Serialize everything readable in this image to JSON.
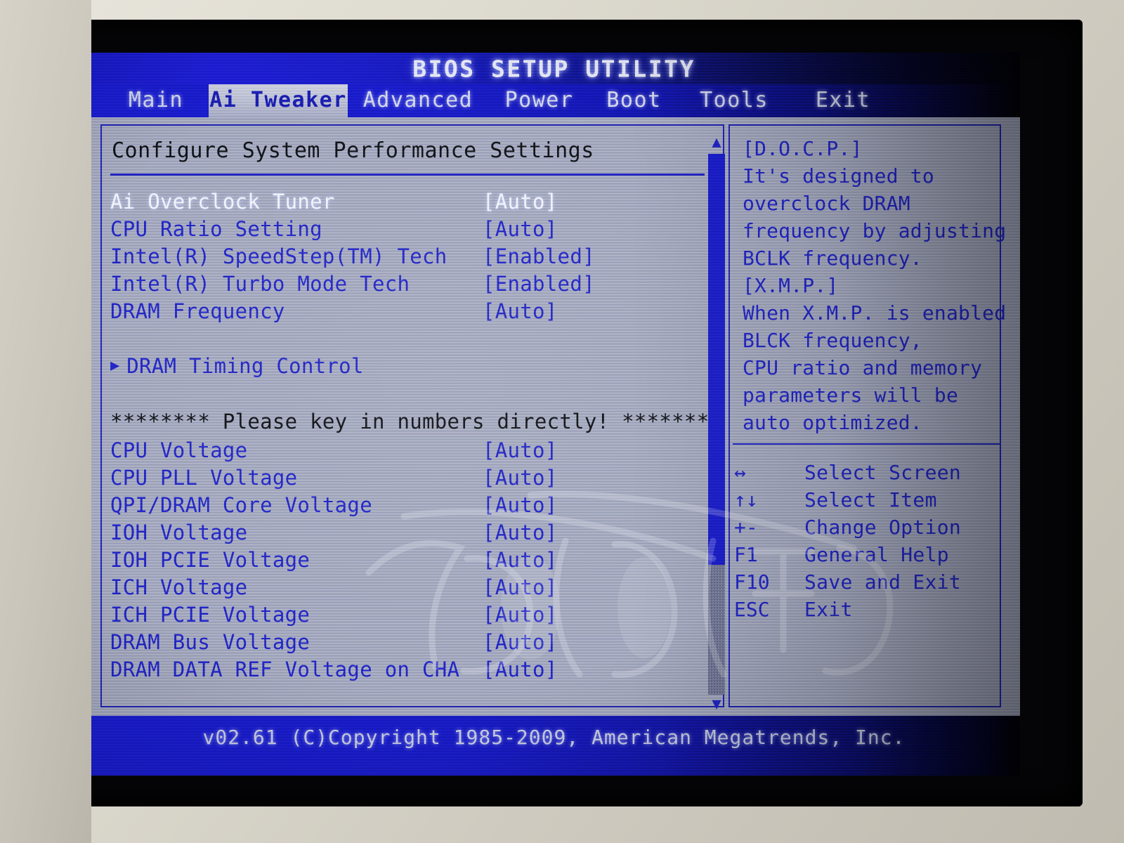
{
  "window": {
    "title": "BIOS SETUP UTILITY"
  },
  "menu": {
    "tabs": [
      {
        "label": "Main",
        "active": false
      },
      {
        "label": "Ai Tweaker",
        "active": true
      },
      {
        "label": "Advanced",
        "active": false
      },
      {
        "label": "Power",
        "active": false
      },
      {
        "label": "Boot",
        "active": false
      },
      {
        "label": "Tools",
        "active": false
      },
      {
        "label": "Exit",
        "active": false
      }
    ]
  },
  "main": {
    "heading": "Configure System Performance Settings",
    "notice": "******** Please key in numbers directly! ********",
    "items": [
      {
        "label": "Ai Overclock Tuner",
        "value": "[Auto]",
        "selected": true
      },
      {
        "label": "CPU Ratio Setting",
        "value": "[Auto]",
        "selected": false
      },
      {
        "label": "Intel(R) SpeedStep(TM) Tech",
        "value": "[Enabled]",
        "selected": false
      },
      {
        "label": "Intel(R) Turbo Mode Tech",
        "value": "[Enabled]",
        "selected": false
      },
      {
        "label": "DRAM Frequency",
        "value": "[Auto]",
        "selected": false
      }
    ],
    "submenu": {
      "arrow": "submenu-arrow-icon",
      "label": "DRAM Timing Control"
    },
    "voltage_items": [
      {
        "label": "CPU Voltage",
        "value": "[Auto]"
      },
      {
        "label": "CPU PLL Voltage",
        "value": "[Auto]"
      },
      {
        "label": "QPI/DRAM Core Voltage",
        "value": "[Auto]"
      },
      {
        "label": "IOH Voltage",
        "value": "[Auto]"
      },
      {
        "label": "IOH PCIE Voltage",
        "value": "[Auto]"
      },
      {
        "label": "ICH Voltage",
        "value": "[Auto]"
      },
      {
        "label": "ICH PCIE Voltage",
        "value": "[Auto]"
      },
      {
        "label": "DRAM Bus Voltage",
        "value": "[Auto]"
      },
      {
        "label": "DRAM DATA REF Voltage on CHA",
        "value": "[Auto]"
      }
    ],
    "scrollbar": {
      "up_arrow": "▲",
      "down_arrow": "▼",
      "thumb_percent": 76
    }
  },
  "help": {
    "lines": [
      "[D.O.C.P.]",
      "It's designed to",
      "overclock DRAM",
      "frequency by adjusting",
      "BCLK frequency.",
      "[X.M.P.]",
      "When X.M.P. is enabled",
      "BLCK frequency,",
      "CPU ratio and memory",
      "parameters will be",
      "auto optimized."
    ],
    "keys": [
      {
        "key": "↔",
        "desc": "Select Screen"
      },
      {
        "key": "↑↓",
        "desc": "Select Item"
      },
      {
        "key": "+-",
        "desc": "Change Option"
      },
      {
        "key": "F1",
        "desc": "General Help"
      },
      {
        "key": "F10",
        "desc": "Save and Exit"
      },
      {
        "key": "ESC",
        "desc": "Exit"
      }
    ]
  },
  "footer": {
    "copyright": "v02.61 (C)Copyright 1985-2009, American Megatrends, Inc."
  },
  "colors": {
    "text_blue": "#2226c8",
    "selected_white": "#f2f3fa",
    "heading_black": "#111318",
    "bar_blue": "#1b1ed2",
    "panel_bg": "#a6abc0"
  }
}
